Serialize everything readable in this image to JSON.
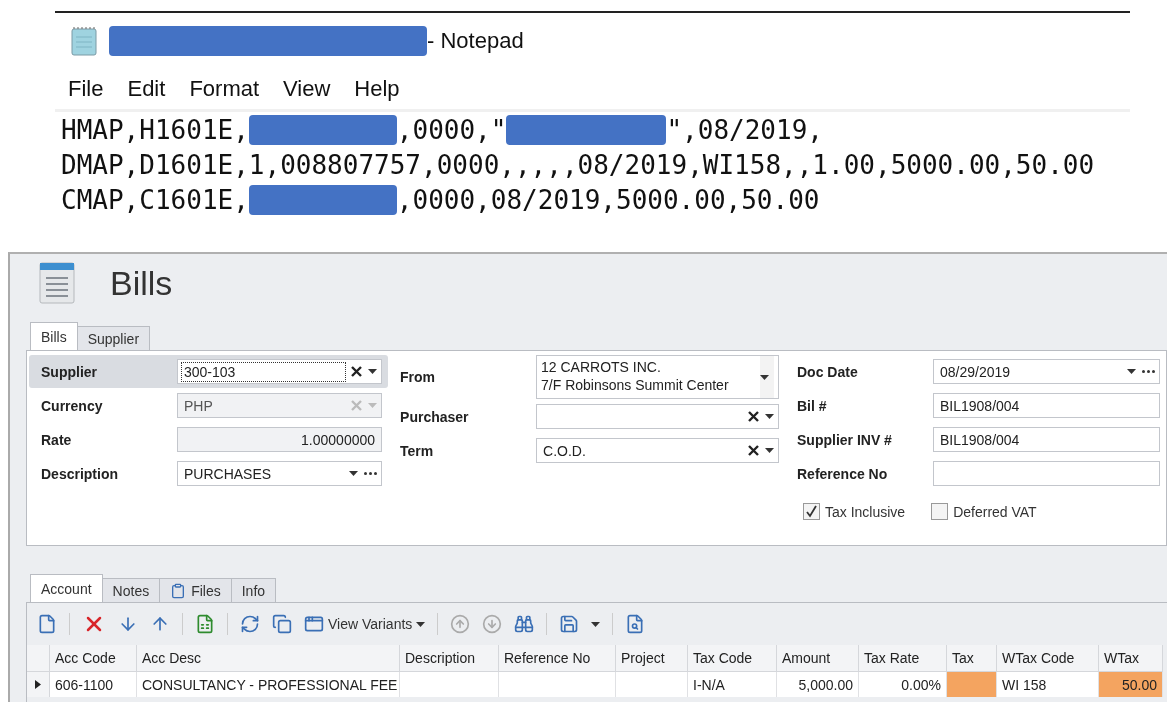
{
  "notepad": {
    "title": [
      {
        "kind": "redacted"
      },
      {
        "kind": "text",
        "text": "- Notepad"
      }
    ],
    "menu": [
      "File",
      "Edit",
      "Format",
      "View",
      "Help"
    ],
    "lines": [
      [
        {
          "kind": "text",
          "text": "HMAP,H1601E,"
        },
        {
          "kind": "redacted"
        },
        {
          "kind": "text",
          "text": ",0000,\""
        },
        {
          "kind": "redacted"
        },
        {
          "kind": "text",
          "text": "\",08/2019,"
        }
      ],
      [
        {
          "kind": "text",
          "text": "DMAP,D1601E,1,008807757,0000,,,,,08/2019,WI158,,1.00,5000.00,50.00"
        }
      ],
      [
        {
          "kind": "text",
          "text": "CMAP,C1601E,"
        },
        {
          "kind": "redacted"
        },
        {
          "kind": "text",
          "text": ",0000,08/2019,5000.00,50.00"
        }
      ]
    ]
  },
  "app": {
    "title": "Bills",
    "tabs": [
      {
        "label": "Bills",
        "selected": true
      },
      {
        "label": "Supplier",
        "selected": false
      }
    ],
    "form": {
      "columns": [
        [
          {
            "label": "Supplier",
            "kind": "combo",
            "value": "300-103",
            "disabled": false,
            "focused": true
          },
          {
            "label": "Currency",
            "kind": "combo",
            "value": "PHP",
            "disabled": true,
            "focused": false
          },
          {
            "label": "Rate",
            "kind": "number",
            "value": "1.00000000",
            "disabled": false,
            "focused": false
          },
          {
            "label": "Description",
            "kind": "dropdown",
            "value": "PURCHASES",
            "disabled": false,
            "focused": false
          }
        ],
        [
          {
            "label": "From",
            "kind": "memo",
            "lines": [
              "12 CARROTS INC.",
              "7/F Robinsons Summit Center"
            ],
            "disabled": false,
            "focused": false
          },
          {
            "label": "Purchaser",
            "kind": "combo",
            "disabled": false,
            "focused": false
          },
          {
            "label": "Term",
            "kind": "combo",
            "value": "C.O.D.",
            "disabled": false,
            "focused": false
          }
        ],
        [
          {
            "label": "Doc Date",
            "kind": "dropdown",
            "value": "08/29/2019",
            "disabled": false,
            "focused": false
          },
          {
            "label": "Bil #",
            "kind": "text",
            "value": "BIL1908/004",
            "disabled": false,
            "focused": false
          },
          {
            "label": "Supplier INV #",
            "kind": "text",
            "value": "BIL1908/004",
            "disabled": false,
            "focused": false
          },
          {
            "label": "Reference No",
            "kind": "text",
            "disabled": false,
            "focused": false
          }
        ]
      ],
      "checkboxes": [
        {
          "label": "Tax Inclusive",
          "checked": true
        },
        {
          "label": "Deferred VAT",
          "checked": false
        }
      ]
    },
    "detail_tabs": [
      {
        "label": "Account",
        "kind": "tab",
        "selected": true
      },
      {
        "label": "Notes",
        "kind": "tab",
        "selected": false
      },
      {
        "label": "Files",
        "kind": "icon-tab",
        "selected": false
      },
      {
        "label": "Info",
        "kind": "tab",
        "selected": false
      }
    ],
    "toolbar": [
      {
        "kind": "icon",
        "disabled": false
      },
      {
        "kind": "separator"
      },
      {
        "kind": "icon",
        "disabled": false
      },
      {
        "kind": "icon",
        "disabled": false
      },
      {
        "kind": "icon",
        "disabled": false
      },
      {
        "kind": "separator"
      },
      {
        "kind": "icon",
        "disabled": false
      },
      {
        "kind": "separator"
      },
      {
        "kind": "icon",
        "disabled": false
      },
      {
        "kind": "icon",
        "disabled": false
      },
      {
        "kind": "menu",
        "label": "View Variants"
      },
      {
        "kind": "separator"
      },
      {
        "kind": "icon",
        "disabled": true
      },
      {
        "kind": "icon",
        "disabled": true
      },
      {
        "kind": "icon",
        "disabled": false
      },
      {
        "kind": "separator"
      },
      {
        "kind": "icon",
        "disabled": false
      },
      {
        "kind": "caret"
      },
      {
        "kind": "separator"
      },
      {
        "kind": "icon",
        "disabled": false
      }
    ],
    "grid": {
      "columns": [
        {
          "label": "Acc Code",
          "kind": "text"
        },
        {
          "label": "Acc Desc",
          "kind": "text"
        },
        {
          "label": "Description",
          "kind": "text"
        },
        {
          "label": "Reference No",
          "kind": "text"
        },
        {
          "label": "Project",
          "kind": "text"
        },
        {
          "label": "Tax Code",
          "kind": "text"
        },
        {
          "label": "Amount",
          "kind": "number"
        },
        {
          "label": "Tax Rate",
          "kind": "number"
        },
        {
          "label": "Tax",
          "kind": "number"
        },
        {
          "label": "WTax Code",
          "kind": "text"
        },
        {
          "label": "WTax",
          "kind": "number"
        }
      ],
      "rows": [
        {
          "current": true,
          "cells": [
            {
              "text": "606-1100",
              "highlighted": false
            },
            {
              "text": "CONSULTANCY - PROFESSIONAL FEE",
              "highlighted": false
            },
            {
              "highlighted": false
            },
            {
              "highlighted": false
            },
            {
              "highlighted": false
            },
            {
              "text": "I-N/A",
              "highlighted": false
            },
            {
              "text": "5,000.00",
              "highlighted": false
            },
            {
              "text": "0.00%",
              "highlighted": false
            },
            {
              "highlighted": true
            },
            {
              "text": "WI 158",
              "highlighted": false
            },
            {
              "text": "50.00",
              "highlighted": true
            }
          ]
        }
      ]
    }
  }
}
